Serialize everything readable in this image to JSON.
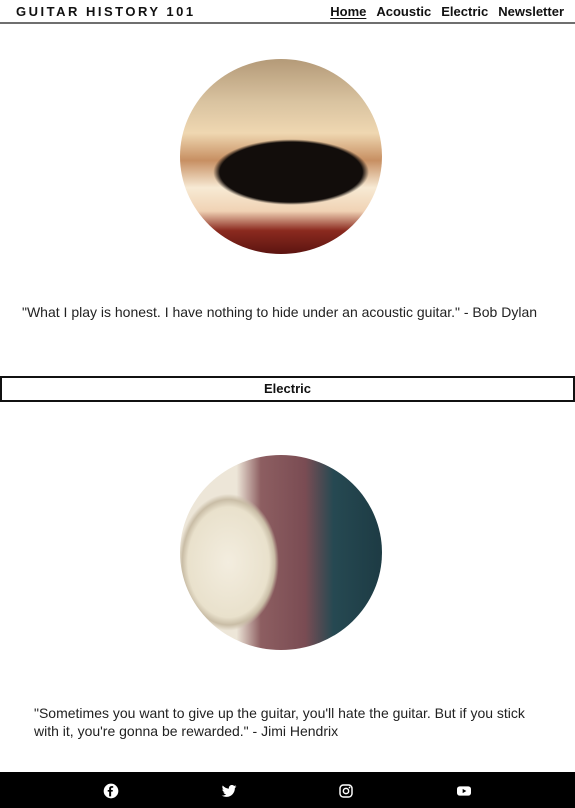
{
  "header": {
    "brand": "GUITAR HISTORY 101",
    "nav": [
      "Home",
      "Acoustic",
      "Electric",
      "Newsletter"
    ],
    "active": "Home"
  },
  "quotes": {
    "acoustic": "\"What I play is honest. I have nothing to hide under an acoustic guitar.\" - Bob Dylan",
    "electric": "\"Sometimes you want to give up the guitar, you'll hate the guitar. But if you stick with it, you're gonna be rewarded.\" - Jimi Hendrix"
  },
  "sections": {
    "electric_title": "Electric"
  },
  "footer": {
    "social_icons": [
      "facebook-icon",
      "twitter-icon",
      "instagram-icon",
      "youtube-icon"
    ]
  },
  "colors": {
    "footer_bg": "#000000",
    "header_border": "#6f6f6f"
  }
}
